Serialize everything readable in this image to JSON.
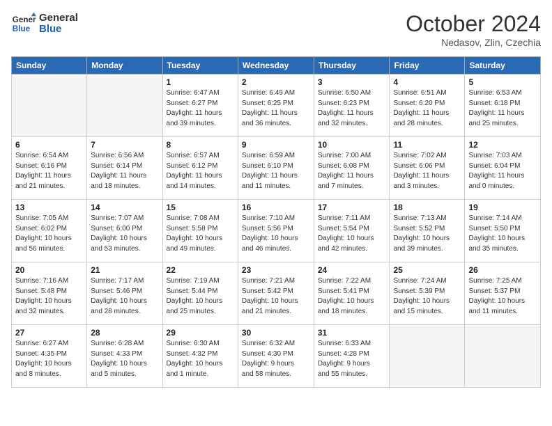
{
  "logo": {
    "line1": "General",
    "line2": "Blue"
  },
  "title": "October 2024",
  "subtitle": "Nedasov, Zlin, Czechia",
  "days_of_week": [
    "Sunday",
    "Monday",
    "Tuesday",
    "Wednesday",
    "Thursday",
    "Friday",
    "Saturday"
  ],
  "weeks": [
    [
      {
        "day": "",
        "info": ""
      },
      {
        "day": "",
        "info": ""
      },
      {
        "day": "1",
        "info": "Sunrise: 6:47 AM\nSunset: 6:27 PM\nDaylight: 11 hours\nand 39 minutes."
      },
      {
        "day": "2",
        "info": "Sunrise: 6:49 AM\nSunset: 6:25 PM\nDaylight: 11 hours\nand 36 minutes."
      },
      {
        "day": "3",
        "info": "Sunrise: 6:50 AM\nSunset: 6:23 PM\nDaylight: 11 hours\nand 32 minutes."
      },
      {
        "day": "4",
        "info": "Sunrise: 6:51 AM\nSunset: 6:20 PM\nDaylight: 11 hours\nand 28 minutes."
      },
      {
        "day": "5",
        "info": "Sunrise: 6:53 AM\nSunset: 6:18 PM\nDaylight: 11 hours\nand 25 minutes."
      }
    ],
    [
      {
        "day": "6",
        "info": "Sunrise: 6:54 AM\nSunset: 6:16 PM\nDaylight: 11 hours\nand 21 minutes."
      },
      {
        "day": "7",
        "info": "Sunrise: 6:56 AM\nSunset: 6:14 PM\nDaylight: 11 hours\nand 18 minutes."
      },
      {
        "day": "8",
        "info": "Sunrise: 6:57 AM\nSunset: 6:12 PM\nDaylight: 11 hours\nand 14 minutes."
      },
      {
        "day": "9",
        "info": "Sunrise: 6:59 AM\nSunset: 6:10 PM\nDaylight: 11 hours\nand 11 minutes."
      },
      {
        "day": "10",
        "info": "Sunrise: 7:00 AM\nSunset: 6:08 PM\nDaylight: 11 hours\nand 7 minutes."
      },
      {
        "day": "11",
        "info": "Sunrise: 7:02 AM\nSunset: 6:06 PM\nDaylight: 11 hours\nand 3 minutes."
      },
      {
        "day": "12",
        "info": "Sunrise: 7:03 AM\nSunset: 6:04 PM\nDaylight: 11 hours\nand 0 minutes."
      }
    ],
    [
      {
        "day": "13",
        "info": "Sunrise: 7:05 AM\nSunset: 6:02 PM\nDaylight: 10 hours\nand 56 minutes."
      },
      {
        "day": "14",
        "info": "Sunrise: 7:07 AM\nSunset: 6:00 PM\nDaylight: 10 hours\nand 53 minutes."
      },
      {
        "day": "15",
        "info": "Sunrise: 7:08 AM\nSunset: 5:58 PM\nDaylight: 10 hours\nand 49 minutes."
      },
      {
        "day": "16",
        "info": "Sunrise: 7:10 AM\nSunset: 5:56 PM\nDaylight: 10 hours\nand 46 minutes."
      },
      {
        "day": "17",
        "info": "Sunrise: 7:11 AM\nSunset: 5:54 PM\nDaylight: 10 hours\nand 42 minutes."
      },
      {
        "day": "18",
        "info": "Sunrise: 7:13 AM\nSunset: 5:52 PM\nDaylight: 10 hours\nand 39 minutes."
      },
      {
        "day": "19",
        "info": "Sunrise: 7:14 AM\nSunset: 5:50 PM\nDaylight: 10 hours\nand 35 minutes."
      }
    ],
    [
      {
        "day": "20",
        "info": "Sunrise: 7:16 AM\nSunset: 5:48 PM\nDaylight: 10 hours\nand 32 minutes."
      },
      {
        "day": "21",
        "info": "Sunrise: 7:17 AM\nSunset: 5:46 PM\nDaylight: 10 hours\nand 28 minutes."
      },
      {
        "day": "22",
        "info": "Sunrise: 7:19 AM\nSunset: 5:44 PM\nDaylight: 10 hours\nand 25 minutes."
      },
      {
        "day": "23",
        "info": "Sunrise: 7:21 AM\nSunset: 5:42 PM\nDaylight: 10 hours\nand 21 minutes."
      },
      {
        "day": "24",
        "info": "Sunrise: 7:22 AM\nSunset: 5:41 PM\nDaylight: 10 hours\nand 18 minutes."
      },
      {
        "day": "25",
        "info": "Sunrise: 7:24 AM\nSunset: 5:39 PM\nDaylight: 10 hours\nand 15 minutes."
      },
      {
        "day": "26",
        "info": "Sunrise: 7:25 AM\nSunset: 5:37 PM\nDaylight: 10 hours\nand 11 minutes."
      }
    ],
    [
      {
        "day": "27",
        "info": "Sunrise: 6:27 AM\nSunset: 4:35 PM\nDaylight: 10 hours\nand 8 minutes."
      },
      {
        "day": "28",
        "info": "Sunrise: 6:28 AM\nSunset: 4:33 PM\nDaylight: 10 hours\nand 5 minutes."
      },
      {
        "day": "29",
        "info": "Sunrise: 6:30 AM\nSunset: 4:32 PM\nDaylight: 10 hours\nand 1 minute."
      },
      {
        "day": "30",
        "info": "Sunrise: 6:32 AM\nSunset: 4:30 PM\nDaylight: 9 hours\nand 58 minutes."
      },
      {
        "day": "31",
        "info": "Sunrise: 6:33 AM\nSunset: 4:28 PM\nDaylight: 9 hours\nand 55 minutes."
      },
      {
        "day": "",
        "info": ""
      },
      {
        "day": "",
        "info": ""
      }
    ]
  ]
}
